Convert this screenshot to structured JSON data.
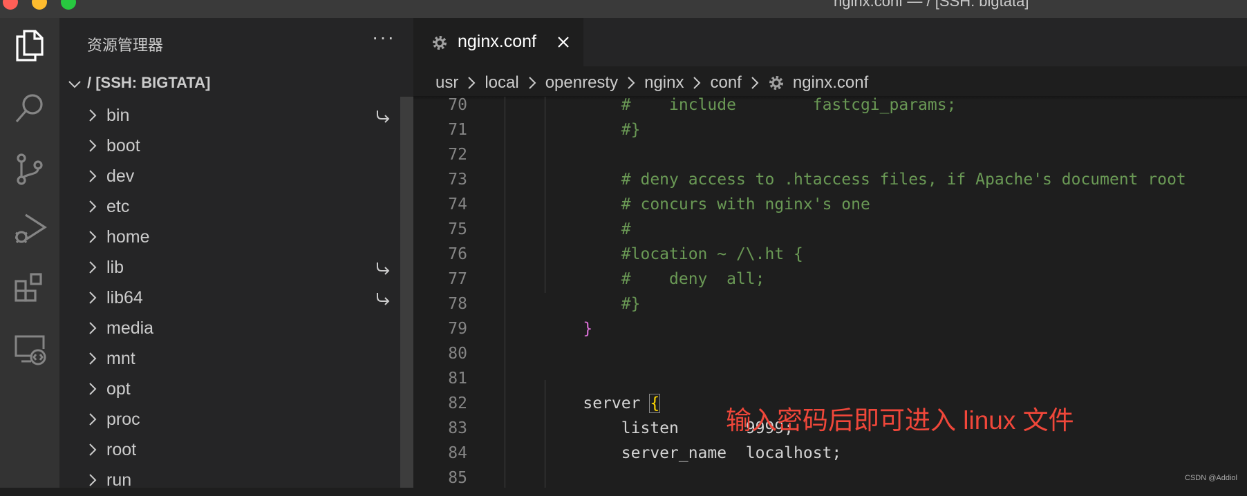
{
  "window": {
    "title": "nginx.conf — / [SSH: bigtata]"
  },
  "activity_bar": {
    "items": [
      {
        "name": "explorer-icon",
        "active": true
      },
      {
        "name": "search-icon"
      },
      {
        "name": "source-control-icon"
      },
      {
        "name": "run-debug-icon"
      },
      {
        "name": "extensions-icon"
      },
      {
        "name": "remote-explorer-icon"
      }
    ]
  },
  "sidebar": {
    "title": "资源管理器",
    "more": "···",
    "root_label": "/ [SSH: BIGTATA]",
    "items": [
      {
        "label": "bin",
        "symlink": true
      },
      {
        "label": "boot",
        "symlink": false
      },
      {
        "label": "dev",
        "symlink": false
      },
      {
        "label": "etc",
        "symlink": false
      },
      {
        "label": "home",
        "symlink": false
      },
      {
        "label": "lib",
        "symlink": true
      },
      {
        "label": "lib64",
        "symlink": true
      },
      {
        "label": "media",
        "symlink": false
      },
      {
        "label": "mnt",
        "symlink": false
      },
      {
        "label": "opt",
        "symlink": false
      },
      {
        "label": "proc",
        "symlink": false
      },
      {
        "label": "root",
        "symlink": false
      },
      {
        "label": "run",
        "symlink": false
      }
    ]
  },
  "editor": {
    "tab": {
      "label": "nginx.conf"
    },
    "breadcrumb": [
      "usr",
      "local",
      "openresty",
      "nginx",
      "conf",
      "nginx.conf"
    ],
    "lines": [
      {
        "n": "70",
        "text": "        #    include        fastcgi_params;",
        "kind": "comment"
      },
      {
        "n": "71",
        "text": "        #}",
        "kind": "comment"
      },
      {
        "n": "72",
        "text": "",
        "kind": "plain"
      },
      {
        "n": "73",
        "text": "        # deny access to .htaccess files, if Apache's document root",
        "kind": "comment"
      },
      {
        "n": "74",
        "text": "        # concurs with nginx's one",
        "kind": "comment"
      },
      {
        "n": "75",
        "text": "        #",
        "kind": "comment"
      },
      {
        "n": "76",
        "text": "        #location ~ /\\.ht {",
        "kind": "comment"
      },
      {
        "n": "77",
        "text": "        #    deny  all;",
        "kind": "comment"
      },
      {
        "n": "78",
        "text": "        #}",
        "kind": "comment"
      },
      {
        "n": "79",
        "text": "    }",
        "kind": "brace-pink"
      },
      {
        "n": "80",
        "text": "",
        "kind": "plain"
      },
      {
        "n": "81",
        "text": "",
        "kind": "plain"
      },
      {
        "n": "82",
        "text": "    server ",
        "kind": "server-open"
      },
      {
        "n": "83",
        "text": "        listen       9999;",
        "kind": "plain"
      },
      {
        "n": "84",
        "text": "        server_name  localhost;",
        "kind": "plain"
      },
      {
        "n": "85",
        "text": "",
        "kind": "plain"
      }
    ],
    "open_brace": "{"
  },
  "annotation": "输入密码后即可进入 linux 文件",
  "watermark": "CSDN @Addiol",
  "colors": {
    "comment": "#6a9955",
    "annotation": "#f0473a",
    "brace_pink": "#da70d6",
    "brace_yellow": "#ffd700"
  }
}
